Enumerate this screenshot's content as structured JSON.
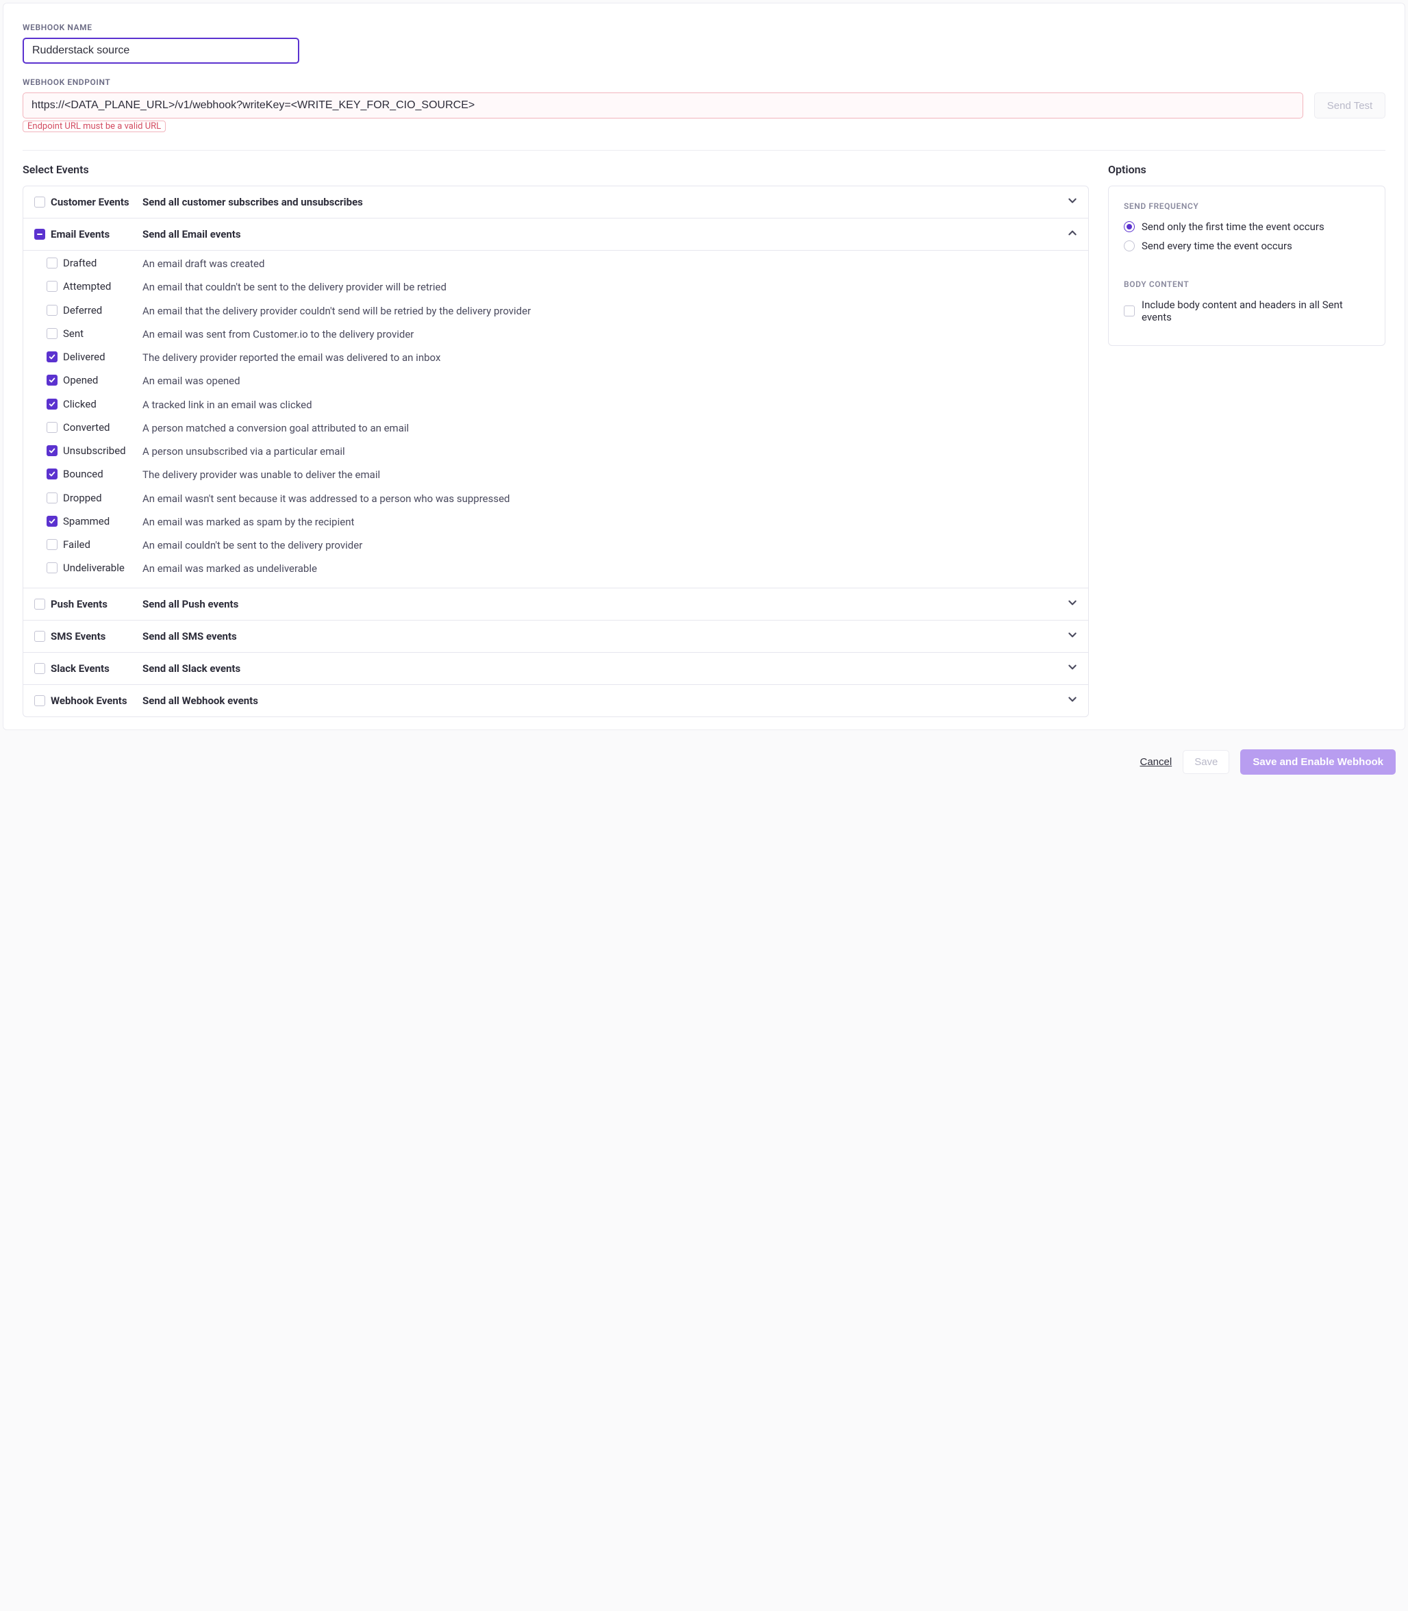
{
  "webhookName": {
    "label": "WEBHOOK NAME",
    "value": "Rudderstack source"
  },
  "webhookEndpoint": {
    "label": "WEBHOOK ENDPOINT",
    "value": "https://<DATA_PLANE_URL>/v1/webhook?writeKey=<WRITE_KEY_FOR_CIO_SOURCE>",
    "error": "Endpoint URL must be a valid URL"
  },
  "sendTest": "Send Test",
  "selectEvents": {
    "title": "Select Events",
    "groups": [
      {
        "name": "Customer Events",
        "desc": "Send all customer subscribes and unsubscribes",
        "checked": false,
        "indeterminate": false,
        "expanded": false
      },
      {
        "name": "Email Events",
        "desc": "Send all Email events",
        "checked": false,
        "indeterminate": true,
        "expanded": true,
        "children": [
          {
            "name": "Drafted",
            "desc": "An email draft was created",
            "checked": false
          },
          {
            "name": "Attempted",
            "desc": "An email that couldn't be sent to the delivery provider will be retried",
            "checked": false
          },
          {
            "name": "Deferred",
            "desc": "An email that the delivery provider couldn't send will be retried by the delivery provider",
            "checked": false
          },
          {
            "name": "Sent",
            "desc": "An email was sent from Customer.io to the delivery provider",
            "checked": false
          },
          {
            "name": "Delivered",
            "desc": "The delivery provider reported the email was delivered to an inbox",
            "checked": true
          },
          {
            "name": "Opened",
            "desc": "An email was opened",
            "checked": true
          },
          {
            "name": "Clicked",
            "desc": "A tracked link in an email was clicked",
            "checked": true
          },
          {
            "name": "Converted",
            "desc": "A person matched a conversion goal attributed to an email",
            "checked": false
          },
          {
            "name": "Unsubscribed",
            "desc": "A person unsubscribed via a particular email",
            "checked": true
          },
          {
            "name": "Bounced",
            "desc": "The delivery provider was unable to deliver the email",
            "checked": true
          },
          {
            "name": "Dropped",
            "desc": "An email wasn't sent because it was addressed to a person who was suppressed",
            "checked": false
          },
          {
            "name": "Spammed",
            "desc": "An email was marked as spam by the recipient",
            "checked": true
          },
          {
            "name": "Failed",
            "desc": "An email couldn't be sent to the delivery provider",
            "checked": false
          },
          {
            "name": "Undeliverable",
            "desc": "An email was marked as undeliverable",
            "checked": false
          }
        ]
      },
      {
        "name": "Push Events",
        "desc": "Send all Push events",
        "checked": false,
        "indeterminate": false,
        "expanded": false
      },
      {
        "name": "SMS Events",
        "desc": "Send all SMS events",
        "checked": false,
        "indeterminate": false,
        "expanded": false
      },
      {
        "name": "Slack Events",
        "desc": "Send all Slack events",
        "checked": false,
        "indeterminate": false,
        "expanded": false
      },
      {
        "name": "Webhook Events",
        "desc": "Send all Webhook events",
        "checked": false,
        "indeterminate": false,
        "expanded": false
      }
    ]
  },
  "options": {
    "title": "Options",
    "sendFrequency": {
      "label": "SEND FREQUENCY",
      "choices": [
        {
          "label": "Send only the first time the event occurs",
          "selected": true
        },
        {
          "label": "Send every time the event occurs",
          "selected": false
        }
      ]
    },
    "bodyContent": {
      "label": "BODY CONTENT",
      "checkbox": {
        "label": "Include body content and headers in all Sent events",
        "checked": false
      }
    }
  },
  "footer": {
    "cancel": "Cancel",
    "save": "Save",
    "saveEnable": "Save and Enable Webhook"
  }
}
